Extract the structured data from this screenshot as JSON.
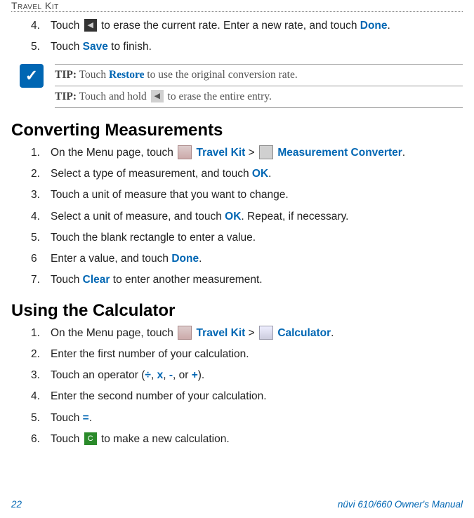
{
  "header": {
    "title": "Travel Kit"
  },
  "top_steps": [
    {
      "num": "4.",
      "prefix": "Touch ",
      "suffix": " to erase the current rate. Enter a new rate, and touch ",
      "link": "Done",
      "end": "."
    },
    {
      "num": "5.",
      "prefix": "Touch ",
      "link": "Save",
      "suffix": " to finish."
    }
  ],
  "tips": {
    "tip1_label": "TIP:",
    "tip1_prefix": " Touch ",
    "tip1_link": "Restore",
    "tip1_suffix": " to use the original conversion rate.",
    "tip2_label": "TIP:",
    "tip2_prefix": " Touch and hold ",
    "tip2_suffix": " to erase the entire entry."
  },
  "section1": {
    "heading": "Converting Measurements",
    "s1_num": "1.",
    "s1_a": "On the Menu page, touch ",
    "s1_link1": "Travel Kit",
    "s1_gt": " > ",
    "s1_link2": "Measurement Converter",
    "s1_end": ".",
    "s2_num": "2.",
    "s2_a": "Select a type of measurement, and touch ",
    "s2_link": "OK",
    "s2_end": ".",
    "s3_num": "3.",
    "s3_a": "Touch a unit of measure that you want to change.",
    "s4_num": "4.",
    "s4_a": "Select a unit of measure, and touch ",
    "s4_link": "OK",
    "s4_end": ". Repeat, if necessary.",
    "s5_num": "5.",
    "s5_a": "Touch the blank rectangle to enter a value.",
    "s6_num": "6",
    "s6_a": "Enter a value, and touch ",
    "s6_link": "Done",
    "s6_end": ".",
    "s7_num": "7.",
    "s7_a": "Touch ",
    "s7_link": "Clear",
    "s7_end": " to enter another measurement."
  },
  "section2": {
    "heading": "Using the Calculator",
    "c1_num": "1.",
    "c1_a": "On the Menu page, touch ",
    "c1_link1": "Travel Kit",
    "c1_gt": " > ",
    "c1_link2": "Calculator",
    "c1_end": ".",
    "c2_num": "2.",
    "c2_a": "Enter the first number of your calculation.",
    "c3_num": "3.",
    "c3_a": "Touch an operator (",
    "c3_op1": "÷",
    "c3_sep1": ", ",
    "c3_op2": "x",
    "c3_sep2": ", ",
    "c3_op3": "-",
    "c3_sep3": ", or ",
    "c3_op4": "+",
    "c3_end": ").",
    "c4_num": "4.",
    "c4_a": "Enter the second number of your calculation.",
    "c5_num": "5.",
    "c5_a": "Touch ",
    "c5_link": "=",
    "c5_end": ".",
    "c6_num": "6.",
    "c6_a": "Touch ",
    "c6_end": " to make a new calculation."
  },
  "icons": {
    "c_letter": "C"
  },
  "footer": {
    "page": "22",
    "manual": "nüvi 610/660 Owner's Manual"
  }
}
